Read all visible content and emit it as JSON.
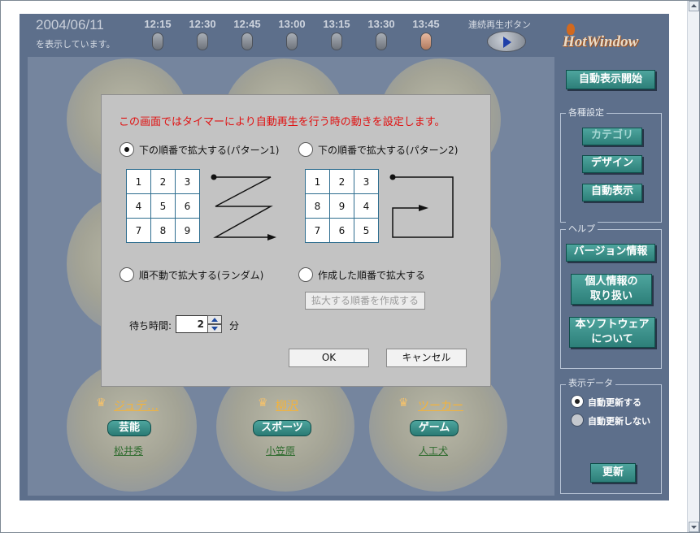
{
  "header": {
    "date": "2004/06/11",
    "date_caption": "を表示しています。",
    "time_slots": [
      "12:15",
      "12:30",
      "12:45",
      "13:00",
      "13:15",
      "13:30",
      "13:45"
    ],
    "active_slot": "13:45",
    "play_label": "連続再生ボタン",
    "logo": "HotWindow"
  },
  "sidebar": {
    "auto_display_start": "自動表示開始",
    "settings_group": {
      "label": "各種設定",
      "buttons": [
        "カテゴリ",
        "デザイン",
        "自動表示"
      ]
    },
    "help_group": {
      "label": "ヘルプ",
      "version": "バージョン情報",
      "privacy_line1": "個人情報の",
      "privacy_line2": "取り扱い",
      "about_line1": "本ソフトウェア",
      "about_line2": "について"
    },
    "data_group": {
      "label": "表示データ",
      "auto_update": "自動更新する",
      "no_auto_update": "自動更新しない",
      "selected": "自動更新する",
      "refresh": "更新"
    }
  },
  "items": [
    {
      "title": "ジュデ…",
      "category": "芸能",
      "person": "松井秀"
    },
    {
      "title": "柳沢",
      "category": "スポーツ",
      "person": "小笠原"
    },
    {
      "title": "ツーカー",
      "category": "ゲーム",
      "person": "人工犬"
    }
  ],
  "dialog": {
    "title": "この画面ではタイマーにより自動再生を行う時の動きを設定します。",
    "options": {
      "pattern1": "下の順番で拡大する(パターン1)",
      "pattern2": "下の順番で拡大する(パターン2)",
      "random": "順不動で拡大する(ランダム)",
      "custom": "作成した順番で拡大する"
    },
    "selected_option": "pattern1",
    "grid1": [
      [
        "1",
        "2",
        "3"
      ],
      [
        "4",
        "5",
        "6"
      ],
      [
        "7",
        "8",
        "9"
      ]
    ],
    "grid2": [
      [
        "1",
        "2",
        "3"
      ],
      [
        "8",
        "9",
        "4"
      ],
      [
        "7",
        "6",
        "5"
      ]
    ],
    "create_order_button": "拡大する順番を作成する",
    "wait_label": "待ち時間:",
    "wait_value": "2",
    "wait_unit": "分",
    "ok": "OK",
    "cancel": "キャンセル"
  },
  "colors": {
    "app_bg": "#5d6f8b",
    "teal_button": "#3a918b",
    "dialog_bg": "#c3c3c3",
    "title_red": "#e01010",
    "link_orange": "#f4b33a"
  }
}
